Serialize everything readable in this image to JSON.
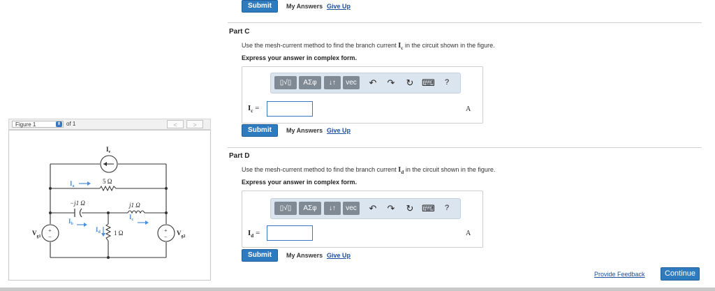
{
  "top": {
    "submit_label": "Submit",
    "my_answers_label": "My Answers",
    "give_up_label": "Give Up"
  },
  "part_c": {
    "title": "Part C",
    "prompt_before": "Use the mesh-current method to find the branch current",
    "variable": "I",
    "variable_sub": "c",
    "prompt_after": "in the circuit shown in the figure.",
    "express": "Express your answer in complex form.",
    "toolbar": {
      "templates_glyph": "▯√▯",
      "greek_label": "ΑΣφ",
      "arrows_label": "↓↑",
      "vec_label": "vec",
      "undo_glyph": "↶",
      "redo_glyph": "↷",
      "reset_glyph": "↻",
      "keyboard_glyph": "⌨",
      "help_label": "?"
    },
    "answer_label": "I",
    "answer_label_sub": "c",
    "answer_eq": "=",
    "input_value": "",
    "unit": "A",
    "submit_label": "Submit",
    "my_answers_label": "My Answers",
    "give_up_label": "Give Up"
  },
  "part_d": {
    "title": "Part D",
    "prompt_before": "Use the mesh-current method to find the branch current",
    "variable": "I",
    "variable_sub": "d",
    "prompt_after": "in the circuit shown in the figure.",
    "express": "Express your answer in complex form.",
    "toolbar": {
      "templates_glyph": "▯√▯",
      "greek_label": "ΑΣφ",
      "arrows_label": "↓↑",
      "vec_label": "vec",
      "undo_glyph": "↶",
      "redo_glyph": "↷",
      "reset_glyph": "↻",
      "keyboard_glyph": "⌨",
      "help_label": "?"
    },
    "answer_label": "I",
    "answer_label_sub": "d",
    "answer_eq": "=",
    "input_value": "",
    "unit": "A",
    "submit_label": "Submit",
    "my_answers_label": "My Answers",
    "give_up_label": "Give Up"
  },
  "figure": {
    "select_label": "Figure 1",
    "of_label": "of 1",
    "prev_glyph": "<",
    "next_glyph": ">",
    "labels": {
      "Ie": "I",
      "Ie_sub": "e",
      "Ia": "I",
      "Ia_sub": "a",
      "Ib": "I",
      "Ib_sub": "b",
      "Ic": "I",
      "Ic_sub": "c",
      "Id": "I",
      "Id_sub": "d",
      "r5": "5 Ω",
      "xc": "−j1 Ω",
      "xl": "j1 Ω",
      "r1": "1 Ω",
      "vg1": "V",
      "vg1_sub": "g1",
      "vg2": "V",
      "vg2_sub": "g2",
      "plus": "+",
      "minus": "−"
    }
  },
  "footer": {
    "feedback_label": "Provide Feedback",
    "continue_label": "Continue"
  },
  "colors": {
    "accent_blue": "#2f7bc0",
    "toolbar_bg": "#dbe5ef",
    "toolbar_btn": "#7f8a94",
    "circuit_line": "#333333",
    "current_arrow": "#4a90d9"
  }
}
